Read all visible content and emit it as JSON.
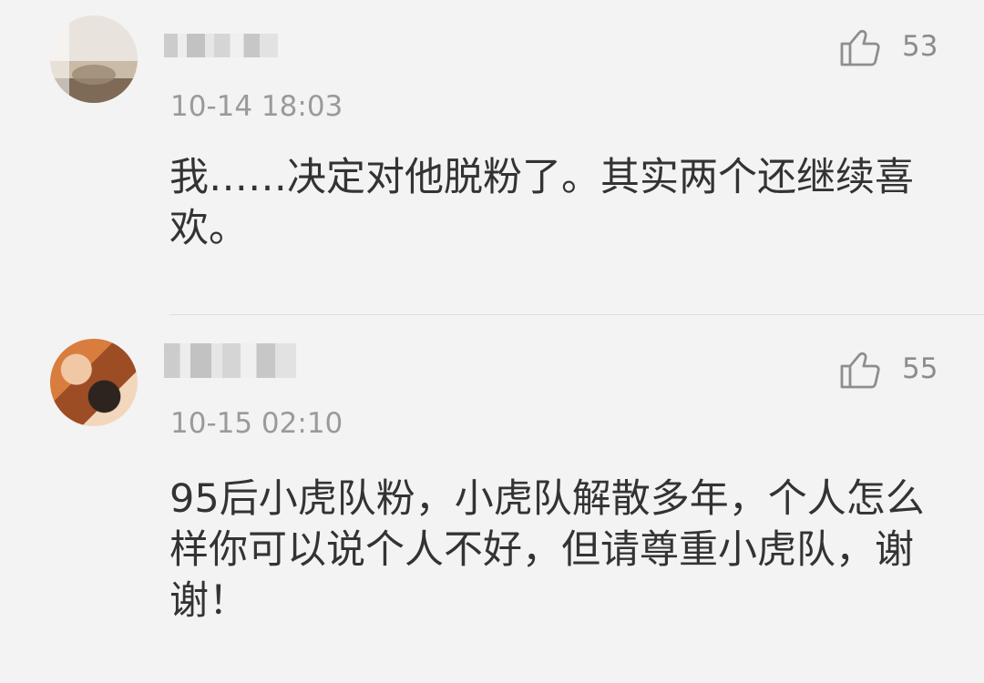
{
  "comments": [
    {
      "timestamp": "10-14 18:03",
      "like_count": "53",
      "content": "我……决定对他脱粉了。其实两个还继续喜欢。",
      "like_icon": "thumb-up-icon"
    },
    {
      "timestamp": "10-15 02:10",
      "like_count": "55",
      "content": "95后小虎队粉，小虎队解散多年，个人怎么样你可以说个人不好，但请尊重小虎队，谢谢！",
      "like_icon": "thumb-up-icon"
    }
  ]
}
